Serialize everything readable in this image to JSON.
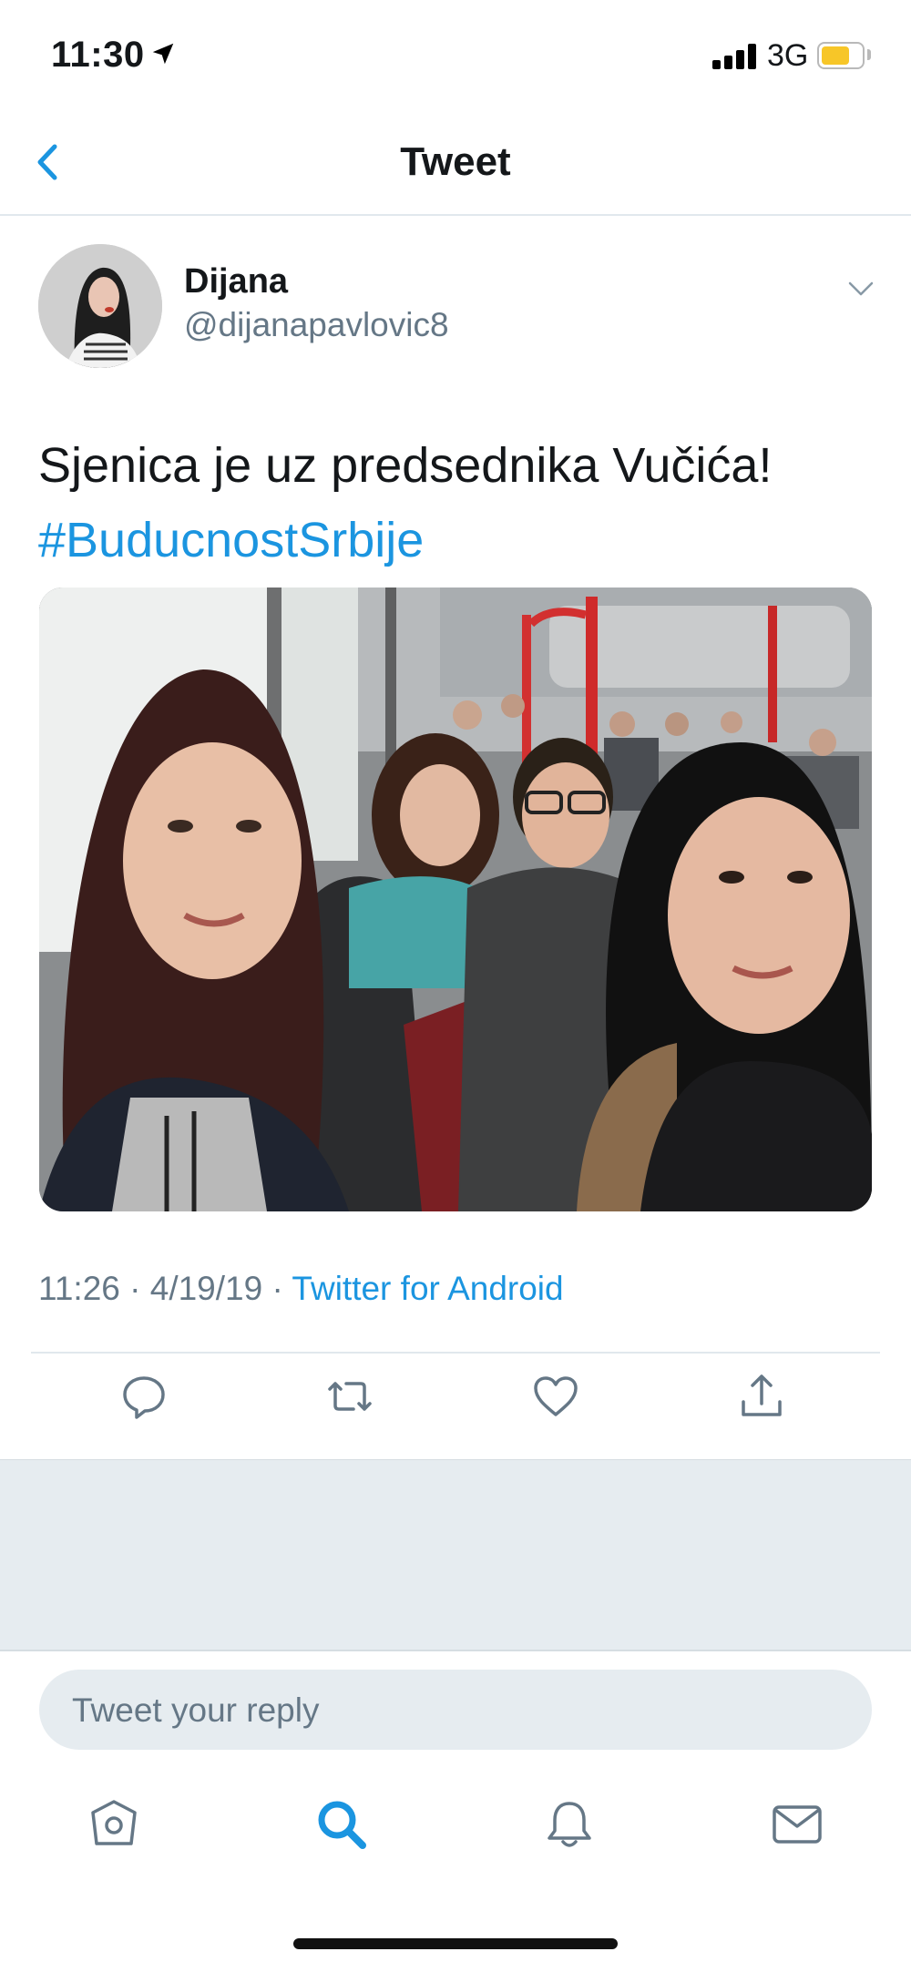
{
  "status_bar": {
    "time": "11:30",
    "network": "3G",
    "icons": [
      "location-arrow-icon",
      "signal-icon",
      "battery-icon"
    ],
    "battery_color": "#f7c628"
  },
  "nav": {
    "title": "Tweet",
    "back_icon": "chevron-left-icon"
  },
  "tweet": {
    "author_name": "Dijana",
    "author_handle": "@dijanapavlovic8",
    "text": "Sjenica je uz predsednika Vučića!",
    "hashtag": "#BuducnostSrbije",
    "time": "11:26",
    "date": "4/19/19",
    "source": "Twitter for Android",
    "photo_alt": "Selfie of four people on a bus"
  },
  "actions": [
    "reply-icon",
    "retweet-icon",
    "like-icon",
    "share-icon"
  ],
  "reply": {
    "placeholder": "Tweet your reply"
  },
  "tabs": [
    "home-icon",
    "search-icon",
    "notifications-icon",
    "messages-icon"
  ],
  "colors": {
    "accent": "#1b95e0",
    "muted_text": "#657786",
    "divider": "#e1e8ed",
    "panel": "#e6ecf0"
  }
}
